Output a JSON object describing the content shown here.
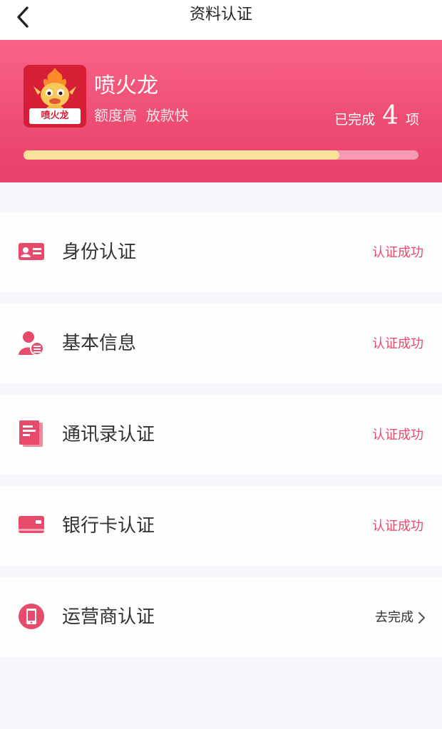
{
  "nav": {
    "title": "资料认证"
  },
  "app": {
    "name": "喷火龙",
    "slogan": "额度高  放款快",
    "logo_text": "喷火龙",
    "completed_prefix": "已完成",
    "completed_count": "4",
    "completed_suffix": "项",
    "progress": 0.8
  },
  "items": [
    {
      "label": "身份认证",
      "status": "认证成功",
      "icon": "id-card-icon"
    },
    {
      "label": "基本信息",
      "status": "认证成功",
      "icon": "user-info-icon"
    },
    {
      "label": "通讯录认证",
      "status": "认证成功",
      "icon": "contacts-book-icon"
    },
    {
      "label": "银行卡认证",
      "status": "认证成功",
      "icon": "bank-card-icon"
    },
    {
      "label": "运营商认证",
      "status": "去完成",
      "icon": "mobile-phone-icon"
    }
  ],
  "colors": {
    "accent": "#e84a6b",
    "banner_top": "#f86387",
    "banner_bottom": "#e8416a",
    "progress_fill": "#fbe29b",
    "progress_track": "#f59ab2"
  }
}
